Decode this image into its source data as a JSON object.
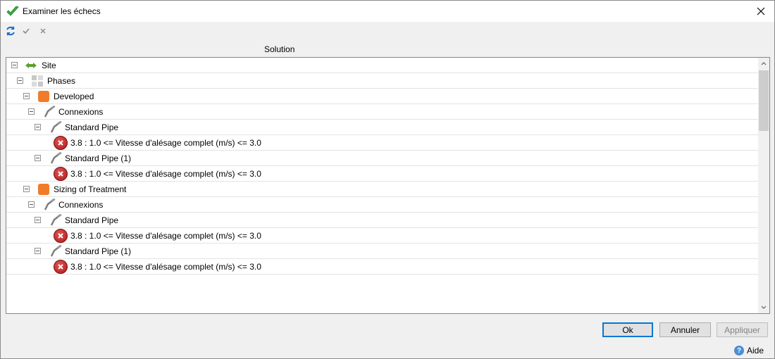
{
  "window": {
    "title": "Examiner les échecs"
  },
  "toolbar": {
    "refresh_icon": "refresh-icon",
    "accept_icon": "check-icon",
    "reject_icon": "x-icon"
  },
  "table": {
    "column_header": "Solution"
  },
  "tree": {
    "site": "Site",
    "phases": "Phases",
    "phase_1": "Developed",
    "connexions_1": "Connexions",
    "pipe_1a": "Standard Pipe",
    "err_1a": "3.8 : 1.0 <= Vitesse d'alésage complet (m/s)  <= 3.0",
    "pipe_1b": "Standard Pipe (1)",
    "err_1b": "3.8 : 1.0 <= Vitesse d'alésage complet (m/s)  <= 3.0",
    "phase_2": "Sizing of Treatment",
    "connexions_2": "Connexions",
    "pipe_2a": "Standard Pipe",
    "err_2a": "3.8 : 1.0 <= Vitesse d'alésage complet (m/s)  <= 3.0",
    "pipe_2b": "Standard Pipe (1)",
    "err_2b": "3.8 : 1.0 <= Vitesse d'alésage complet (m/s)  <= 3.0"
  },
  "buttons": {
    "ok": "Ok",
    "cancel": "Annuler",
    "apply": "Appliquer",
    "help": "Aide"
  },
  "colors": {
    "accent": "#0078d7",
    "error": "#c0392b",
    "phase": "#f07c2a"
  }
}
